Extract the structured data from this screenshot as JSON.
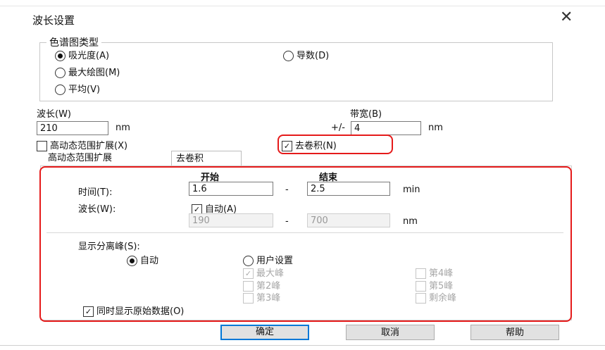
{
  "dialog": {
    "title": "波长设置",
    "close_glyph": "✕"
  },
  "chart_type_group": {
    "label": "色谱图类型",
    "options": [
      {
        "label": "吸光度(A)",
        "selected": true
      },
      {
        "label": "最大绘图(M)",
        "selected": false
      },
      {
        "label": "平均(V)",
        "selected": false
      },
      {
        "label": "导数(D)",
        "selected": false
      }
    ]
  },
  "wavelength": {
    "label": "波长(W)",
    "value": "210",
    "unit": "nm"
  },
  "bandwidth": {
    "label": "带宽(B)",
    "prefix": "+/-",
    "value": "4",
    "unit": "nm"
  },
  "hdr_checkbox": {
    "label": "高动态范围扩展(X)",
    "checked": false
  },
  "deconv_checkbox": {
    "label": "去卷积(N)",
    "checked": true
  },
  "tabs": [
    {
      "label": "高动态范围扩展",
      "active": false
    },
    {
      "label": "去卷积",
      "active": true
    }
  ],
  "deconv_panel": {
    "start_header": "开始",
    "end_header": "结束",
    "time_label": "时间(T):",
    "time_start": "1.6",
    "time_end": "2.5",
    "time_unit": "min",
    "dash": "-",
    "wave_label": "波长(W):",
    "auto_label": "自动(A)",
    "wave_start": "190",
    "wave_end": "700",
    "wave_unit": "nm",
    "show_peaks_label": "显示分离峰(S):",
    "auto_radio": "自动",
    "user_radio": "用户设置",
    "peaks": [
      "最大峰",
      "第2峰",
      "第3峰",
      "第4峰",
      "第5峰",
      "剩余峰"
    ],
    "show_raw_label": "同时显示原始数据(O)"
  },
  "buttons": {
    "ok": "确定",
    "cancel": "取消",
    "help": "帮助"
  },
  "colors": {
    "highlight": "#e51a1a",
    "default_button_border": "#0078d7"
  }
}
